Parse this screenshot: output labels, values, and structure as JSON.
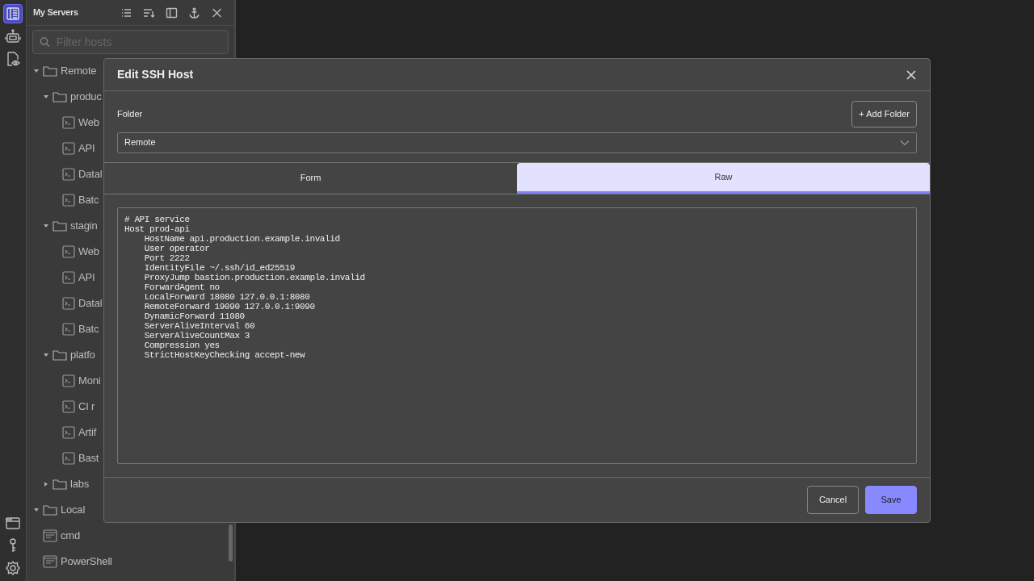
{
  "activity_bar": {
    "top": [
      {
        "kind": "panel",
        "selected": true
      },
      {
        "kind": "robot",
        "selected": false
      },
      {
        "kind": "document",
        "selected": false
      }
    ],
    "bottom": [
      {
        "kind": "window",
        "selected": false
      },
      {
        "kind": "key",
        "selected": false
      },
      {
        "kind": "gear",
        "selected": false
      }
    ]
  },
  "sidebar": {
    "title": "My Servers",
    "search": {
      "placeholder": "Filter hosts"
    },
    "tree": [
      {
        "label": "Remote",
        "kind": "folder",
        "expanded": true,
        "children": [
          {
            "label": "produc",
            "kind": "folder",
            "expanded": true,
            "children": [
              {
                "label": "Web",
                "kind": "ssh"
              },
              {
                "label": "API",
                "kind": "ssh"
              },
              {
                "label": "Datal",
                "kind": "ssh"
              },
              {
                "label": "Batc",
                "kind": "ssh"
              }
            ]
          },
          {
            "label": "stagin",
            "kind": "folder",
            "expanded": true,
            "children": [
              {
                "label": "Web",
                "kind": "ssh"
              },
              {
                "label": "API",
                "kind": "ssh"
              },
              {
                "label": "Datal",
                "kind": "ssh"
              },
              {
                "label": "Batc",
                "kind": "ssh"
              }
            ]
          },
          {
            "label": "platfo",
            "kind": "folder",
            "expanded": true,
            "children": [
              {
                "label": "Moni",
                "kind": "ssh"
              },
              {
                "label": "CI r",
                "kind": "ssh"
              },
              {
                "label": "Artif",
                "kind": "ssh"
              },
              {
                "label": "Bast",
                "kind": "ssh"
              }
            ]
          },
          {
            "label": "labs",
            "kind": "folder",
            "expanded": false
          }
        ]
      },
      {
        "label": "Local",
        "kind": "folder",
        "expanded": true,
        "children": [
          {
            "label": "cmd",
            "kind": "terminal"
          },
          {
            "label": "PowerShell",
            "kind": "terminal"
          }
        ]
      }
    ]
  },
  "dialog": {
    "title": "Edit SSH Host",
    "folder_label": "Folder",
    "add_folder": "+ Add Folder",
    "folder_value": "Remote",
    "tabs": [
      {
        "label": "Form",
        "selected": false
      },
      {
        "label": "Raw",
        "selected": true
      }
    ],
    "raw_lines": [
      "# API service",
      "Host prod-api",
      "    HostName api.production.example.invalid",
      "    User operator",
      "    Port 2222",
      "    IdentityFile ~/.ssh/id_ed25519",
      "    ProxyJump bastion.production.example.invalid",
      "    ForwardAgent no",
      "    LocalForward 18080 127.0.0.1:8080",
      "    RemoteForward 19090 127.0.0.1:9090",
      "    DynamicForward 11080",
      "    ServerAliveInterval 60",
      "    ServerAliveCountMax 3",
      "    Compression yes",
      "    StrictHostKeyChecking accept-new"
    ],
    "buttons": [
      {
        "label": "Cancel",
        "kind": "secondary"
      },
      {
        "label": "Save",
        "kind": "primary"
      }
    ]
  }
}
